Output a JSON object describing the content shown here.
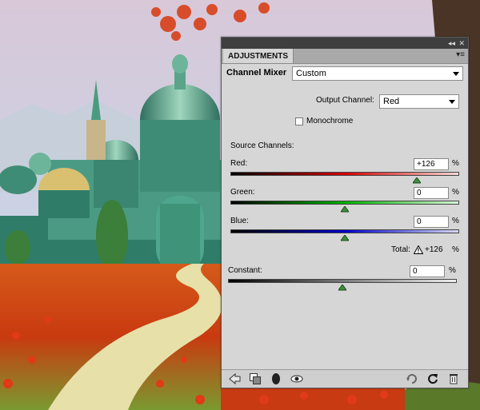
{
  "panel": {
    "tab_label": "ADJUSTMENTS",
    "collapse_icon": "double-chevron-icon",
    "close_icon": "close-icon",
    "menu_icon": "panel-menu-icon"
  },
  "header": {
    "title": "Channel Mixer",
    "preset_value": "Custom"
  },
  "output": {
    "label": "Output Channel:",
    "value": "Red"
  },
  "monochrome": {
    "label": "Monochrome",
    "checked": false
  },
  "source": {
    "label": "Source Channels:",
    "channels": [
      {
        "label": "Red:",
        "value": "+126",
        "level": 126,
        "color": "#d40000"
      },
      {
        "label": "Green:",
        "value": "0",
        "level": 0,
        "color": "#00b000"
      },
      {
        "label": "Blue:",
        "value": "0",
        "level": 0,
        "color": "#0000c8"
      }
    ],
    "percent": "%"
  },
  "total": {
    "label": "Total:",
    "value": "+126",
    "warning_icon": "warning-icon"
  },
  "constant": {
    "label": "Constant:",
    "value": "0",
    "level": 0
  },
  "bottom_icons": {
    "left": [
      "back-arrow-icon",
      "clip-to-layer-icon",
      "visibility-eye-icon",
      "view-previous-icon"
    ],
    "right": [
      "refresh-icon",
      "reset-icon",
      "trash-icon"
    ]
  }
}
